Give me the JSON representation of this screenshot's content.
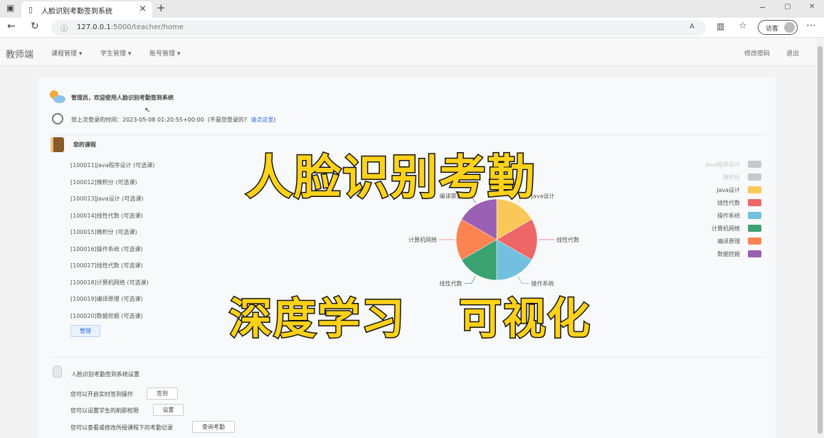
{
  "browser": {
    "tab_title": "人脸识别考勤签到系统",
    "tab_close": "×",
    "new_tab": "+",
    "url_host": "127.0.0.1",
    "url_path": ":5000/teacher/home",
    "guest_label": "访客",
    "win_min": "−",
    "win_max": "▢",
    "win_close": "✕"
  },
  "nav": {
    "brand": "教师端",
    "menus": [
      "课程管理 ▾",
      "学生管理 ▾",
      "账号管理 ▾"
    ],
    "change_password": "修改密码",
    "logout": "退出"
  },
  "welcome": {
    "greeting": "管理员，欢迎使用人脸识别考勤签到系统",
    "last_login_prefix": "您上次登录的时间：",
    "last_login_time": "2023-05-08 01:20:55+00:00",
    "not_you": "(不是您登录的?",
    "login_link": "请点这里",
    "close_paren": ")"
  },
  "courses": {
    "heading": "您的课程",
    "items": [
      "[100011]java程序设计 (可选课)",
      "[100012]微积分 (可选课)",
      "[100013]Java设计 (可选课)",
      "[100014]线性代数 (可选课)",
      "[100015]微积分 (可选课)",
      "[100016]操作系统 (可选课)",
      "[100017]线性代数 (可选课)",
      "[100018]计算机网络 (可选课)",
      "[100019]编译原理 (可选课)",
      "[100020]数据挖掘 (可选课)"
    ],
    "manage_button": "管理"
  },
  "settings": {
    "heading": "人脸识别考勤签到系统设置",
    "rows": [
      {
        "text": "您可以开启实时签到操作",
        "button": "签到"
      },
      {
        "text": "您可以设置学生的削即权限",
        "button": "设置"
      },
      {
        "text": "您可以查看或修改所授课程下的考勤记录",
        "button": "查询考勤"
      }
    ]
  },
  "overlay": {
    "title": "人脸识别考勤",
    "subtitle_left": "深度学习",
    "subtitle_right": "可视化"
  },
  "chart_data": {
    "type": "pie",
    "categories": [
      "java程序设计",
      "微积分",
      "Java设计",
      "线性代数",
      "操作系统",
      "计算机网络",
      "编译原理",
      "数据挖掘"
    ],
    "values": [
      0,
      0,
      1,
      1,
      1,
      1,
      1,
      1
    ],
    "colors": [
      "#c8c8c8",
      "#c8c8c8",
      "#fac858",
      "#ee6666",
      "#73c0de",
      "#3ba272",
      "#fc8452",
      "#9a60b4"
    ],
    "slice_labels": [
      "Java设计",
      "线性代数",
      "操作系统",
      "线性代数",
      "计算机网络",
      "编译原理",
      "数据挖掘"
    ],
    "legend": {
      "placement": "right",
      "items": [
        "java程序设计",
        "微积分",
        "Java设计",
        "线性代数",
        "操作系统",
        "计算机网络",
        "编译原理",
        "数据挖掘"
      ]
    }
  }
}
